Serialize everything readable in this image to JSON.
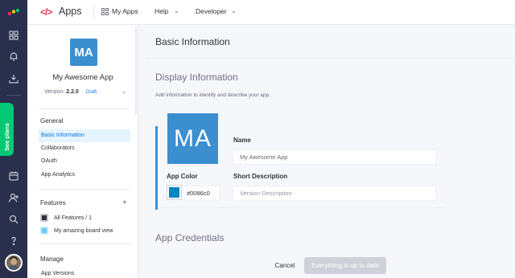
{
  "rail": {
    "icons": [
      "monday-logo",
      "grid-icon",
      "bell-icon",
      "inbox-download-icon",
      "calendar-icon",
      "add-user-icon",
      "search-icon",
      "help-icon",
      "avatar"
    ],
    "see_plans": "See plans",
    "accent_color": "#00c875"
  },
  "header": {
    "title": "Apps",
    "my_apps": "My Apps",
    "help": "Help",
    "developer": "Developer"
  },
  "app": {
    "initials": "MA",
    "name": "My Awesome App",
    "version_label": "Version:",
    "version": "2.2.0",
    "draft": "Draft",
    "brand_color": "#3b8fcf"
  },
  "sidebar": {
    "general_title": "General",
    "general_items": [
      "Basic Information",
      "Collaborators",
      "OAuth",
      "App Analytics"
    ],
    "active_item": "Basic Information",
    "features_title": "Features",
    "features_add": "+",
    "features_items": [
      "All Features / 1",
      "My amazing board view"
    ],
    "manage_title": "Manage",
    "manage_items": [
      "App Versions"
    ]
  },
  "main": {
    "page_title": "Basic Information",
    "display_title": "Display Information",
    "display_desc": "Add information to identify and describe your app.",
    "name_label": "Name",
    "name_value": "My Awesome App",
    "short_desc_label": "Short Description",
    "short_desc_placeholder": "Version Description",
    "app_color_label": "App Color",
    "app_color_value": "#0086c0",
    "credentials_title": "App Credentials",
    "cancel": "Cancel",
    "save": "Everything is up to date"
  }
}
